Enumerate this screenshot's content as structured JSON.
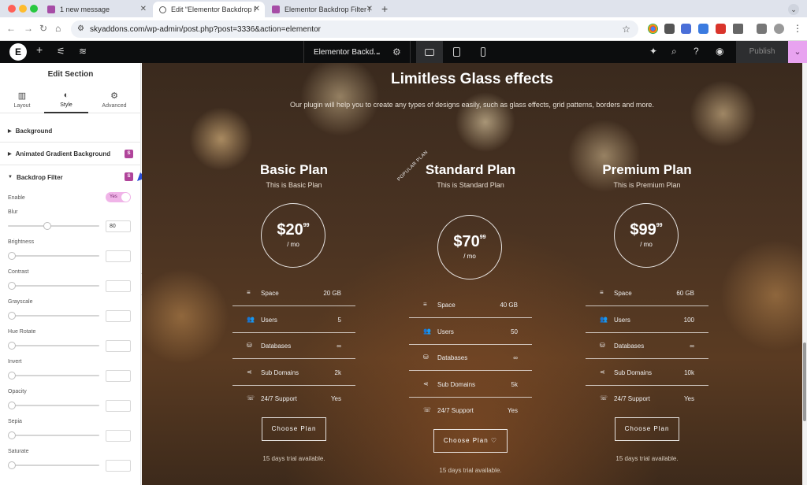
{
  "browser": {
    "tabs": [
      {
        "label": "1 new message",
        "active": false
      },
      {
        "label": "Edit “Elementor Backdrop Filt",
        "active": true
      },
      {
        "label": "Elementor Backdrop Filter Ex",
        "active": false
      }
    ],
    "url": "skyaddons.com/wp-admin/post.php?post=3336&action=elementor",
    "traffic_colors": [
      "#ff5f57",
      "#febc2e",
      "#28c840"
    ]
  },
  "elementor_bar": {
    "document_title": "Elementor Backd...",
    "publish_label": "Publish"
  },
  "panel": {
    "title": "Edit Section",
    "tabs": [
      {
        "label": "Layout",
        "icon": "layout-icon"
      },
      {
        "label": "Style",
        "icon": "contrast-icon"
      },
      {
        "label": "Advanced",
        "icon": "gear-icon"
      }
    ],
    "sections": {
      "background": "Background",
      "animated_gradient": "Animated Gradient Background",
      "backdrop_filter": "Backdrop Filter"
    },
    "enable_label": "Enable",
    "enable_value": "Yes",
    "controls": [
      {
        "label": "Blur",
        "value": "80",
        "level": 0.42
      },
      {
        "label": "Brightness",
        "value": "",
        "level": 0
      },
      {
        "label": "Contrast",
        "value": "",
        "level": 0
      },
      {
        "label": "Grayscale",
        "value": "",
        "level": 0
      },
      {
        "label": "Hue Rotate",
        "value": "",
        "level": 0
      },
      {
        "label": "Invert",
        "value": "",
        "level": 0
      },
      {
        "label": "Opacity",
        "value": "",
        "level": 0
      },
      {
        "label": "Sepia",
        "value": "",
        "level": 0
      },
      {
        "label": "Saturate",
        "value": "",
        "level": 0
      }
    ]
  },
  "preview": {
    "headline": "Limitless Glass effects",
    "subheading": "Our plugin will help you to create any types of designs easily, such as glass effects, grid patterns, borders and more.",
    "ribbon": "POPULAR PLAN",
    "plans": [
      {
        "name": "Basic Plan",
        "desc": "This is Basic Plan",
        "price": "$20",
        "cents": "99",
        "period": "/ mo",
        "features": [
          {
            "label": "Space",
            "value": "20 GB",
            "icon": "server-icon"
          },
          {
            "label": "Users",
            "value": "5",
            "icon": "users-icon"
          },
          {
            "label": "Databases",
            "value": "∞",
            "icon": "database-icon"
          },
          {
            "label": "Sub Domains",
            "value": "2k",
            "icon": "share-icon"
          },
          {
            "label": "24/7 Support",
            "value": "Yes",
            "icon": "support-icon"
          }
        ],
        "button": "Choose Plan",
        "trial": "15 days trial available."
      },
      {
        "name": "Standard Plan",
        "desc": "This is Standard Plan",
        "price": "$70",
        "cents": "99",
        "period": "/ mo",
        "features": [
          {
            "label": "Space",
            "value": "40 GB",
            "icon": "server-icon"
          },
          {
            "label": "Users",
            "value": "50",
            "icon": "users-icon"
          },
          {
            "label": "Databases",
            "value": "∞",
            "icon": "database-icon"
          },
          {
            "label": "Sub Domains",
            "value": "5k",
            "icon": "share-icon"
          },
          {
            "label": "24/7 Support",
            "value": "Yes",
            "icon": "support-icon"
          }
        ],
        "button": "Choose Plan",
        "trial": "15 days trial available."
      },
      {
        "name": "Premium Plan",
        "desc": "This is Premium Plan",
        "price": "$99",
        "cents": "99",
        "period": "/ mo",
        "features": [
          {
            "label": "Space",
            "value": "60 GB",
            "icon": "server-icon"
          },
          {
            "label": "Users",
            "value": "100",
            "icon": "users-icon"
          },
          {
            "label": "Databases",
            "value": "∞",
            "icon": "database-icon"
          },
          {
            "label": "Sub Domains",
            "value": "10k",
            "icon": "share-icon"
          },
          {
            "label": "24/7 Support",
            "value": "Yes",
            "icon": "support-icon"
          }
        ],
        "button": "Choose Plan",
        "trial": "15 days trial available."
      }
    ]
  },
  "colors": {
    "accent": "#b0449a",
    "toggle_on": "#f0b4e8",
    "publish_more": "#e8a3f0",
    "topbar": "#0c0d0e"
  }
}
